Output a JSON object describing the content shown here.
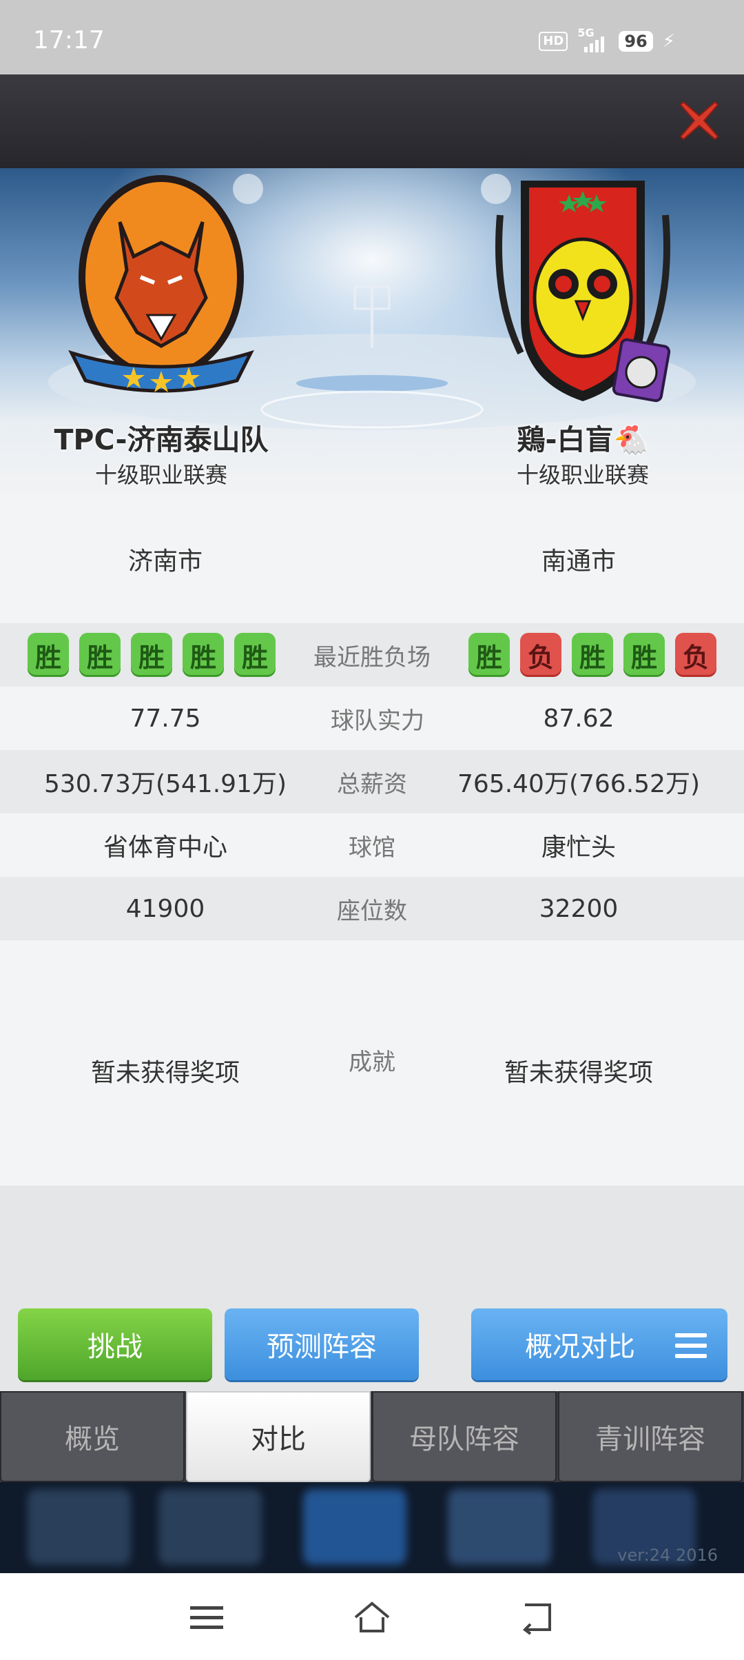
{
  "status_bar": {
    "time": "17:17",
    "hd": "HD",
    "network": "5G",
    "battery": "96"
  },
  "dialog": {
    "close_icon": "close-icon",
    "teams": {
      "left": {
        "name": "TPC-济南泰山队",
        "league": "十级职业联赛"
      },
      "right": {
        "name": "鶏-白盲🐔",
        "league": "十级职业联赛"
      }
    },
    "compare": {
      "city": {
        "left": "济南市",
        "right": "南通市"
      },
      "recent": {
        "label": "最近胜负场",
        "left": [
          "胜",
          "胜",
          "胜",
          "胜",
          "胜"
        ],
        "right": [
          "胜",
          "负",
          "胜",
          "胜",
          "负"
        ]
      },
      "strength": {
        "label": "球队实力",
        "left": "77.75",
        "right": "87.62"
      },
      "salary": {
        "label": "总薪资",
        "left": "530.73万(541.91万)",
        "right": "765.40万(766.52万)"
      },
      "arena": {
        "label": "球馆",
        "left": "省体育中心",
        "right": "康忙头"
      },
      "seats": {
        "label": "座位数",
        "left": "41900",
        "right": "32200"
      },
      "achievements": {
        "label": "成就",
        "left": "暂未获得奖项",
        "right": "暂未获得奖项"
      }
    },
    "buttons": {
      "challenge": "挑战",
      "predict": "预测阵容",
      "overview_compare": "概况对比"
    },
    "tabs": [
      {
        "label": "概览",
        "active": false
      },
      {
        "label": "对比",
        "active": true
      },
      {
        "label": "母队阵容",
        "active": false
      },
      {
        "label": "青训阵容",
        "active": false
      }
    ],
    "version": "ver:24  2016"
  },
  "colors": {
    "win": "#63c84a",
    "loss": "#e0524c",
    "challenge_green": "#5cb82f",
    "primary_blue": "#4a9be6",
    "close_red": "#d83a2a"
  },
  "system_nav": [
    "menu-icon",
    "home-icon",
    "back-icon"
  ]
}
